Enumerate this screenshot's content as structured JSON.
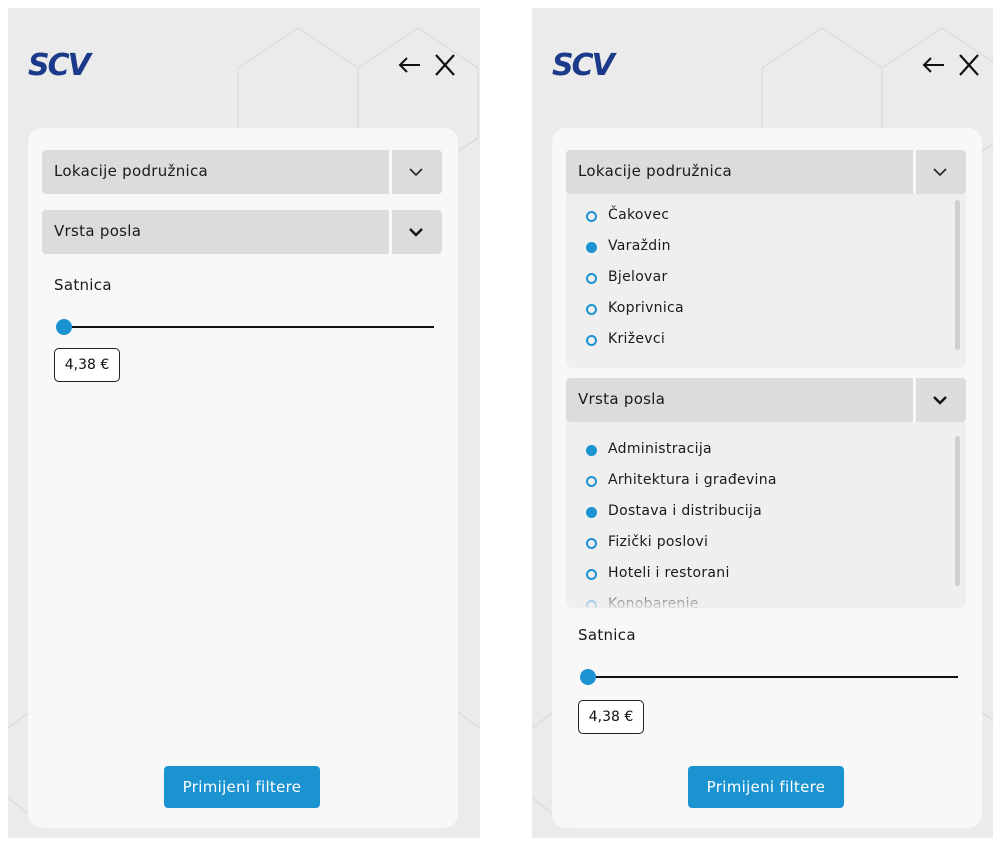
{
  "brand": {
    "logo_text": "SCV",
    "logo_color": "#1c3a8a"
  },
  "colors": {
    "accent": "#1c93d1",
    "background": "#ebebeb",
    "panel": "#f8f8f8",
    "accordion_header": "#dcdcdc"
  },
  "icons": {
    "back": "arrow-left-icon",
    "close": "close-icon",
    "expand": "chevron-down-icon"
  },
  "left_screen": {
    "locations_title": "Lokacije podružnica",
    "job_type_title": "Vrsta posla",
    "rate_label": "Satnica",
    "rate_value": "4,38 €",
    "apply_button": "Primijeni filtere"
  },
  "right_screen": {
    "locations_title": "Lokacije podružnica",
    "locations": [
      {
        "label": "Čakovec",
        "selected": false
      },
      {
        "label": "Varaždin",
        "selected": true
      },
      {
        "label": "Bjelovar",
        "selected": false
      },
      {
        "label": "Koprivnica",
        "selected": false
      },
      {
        "label": "Križevci",
        "selected": false
      }
    ],
    "job_type_title": "Vrsta posla",
    "job_types": [
      {
        "label": "Administracija",
        "selected": true
      },
      {
        "label": "Arhitektura i građevina",
        "selected": false
      },
      {
        "label": "Dostava i distribucija",
        "selected": true
      },
      {
        "label": "Fizički poslovi",
        "selected": false
      },
      {
        "label": "Hoteli i restorani",
        "selected": false
      },
      {
        "label": "Konobarenje",
        "selected": false
      }
    ],
    "rate_label": "Satnica",
    "rate_value": "4,38 €",
    "apply_button": "Primijeni filtere"
  }
}
